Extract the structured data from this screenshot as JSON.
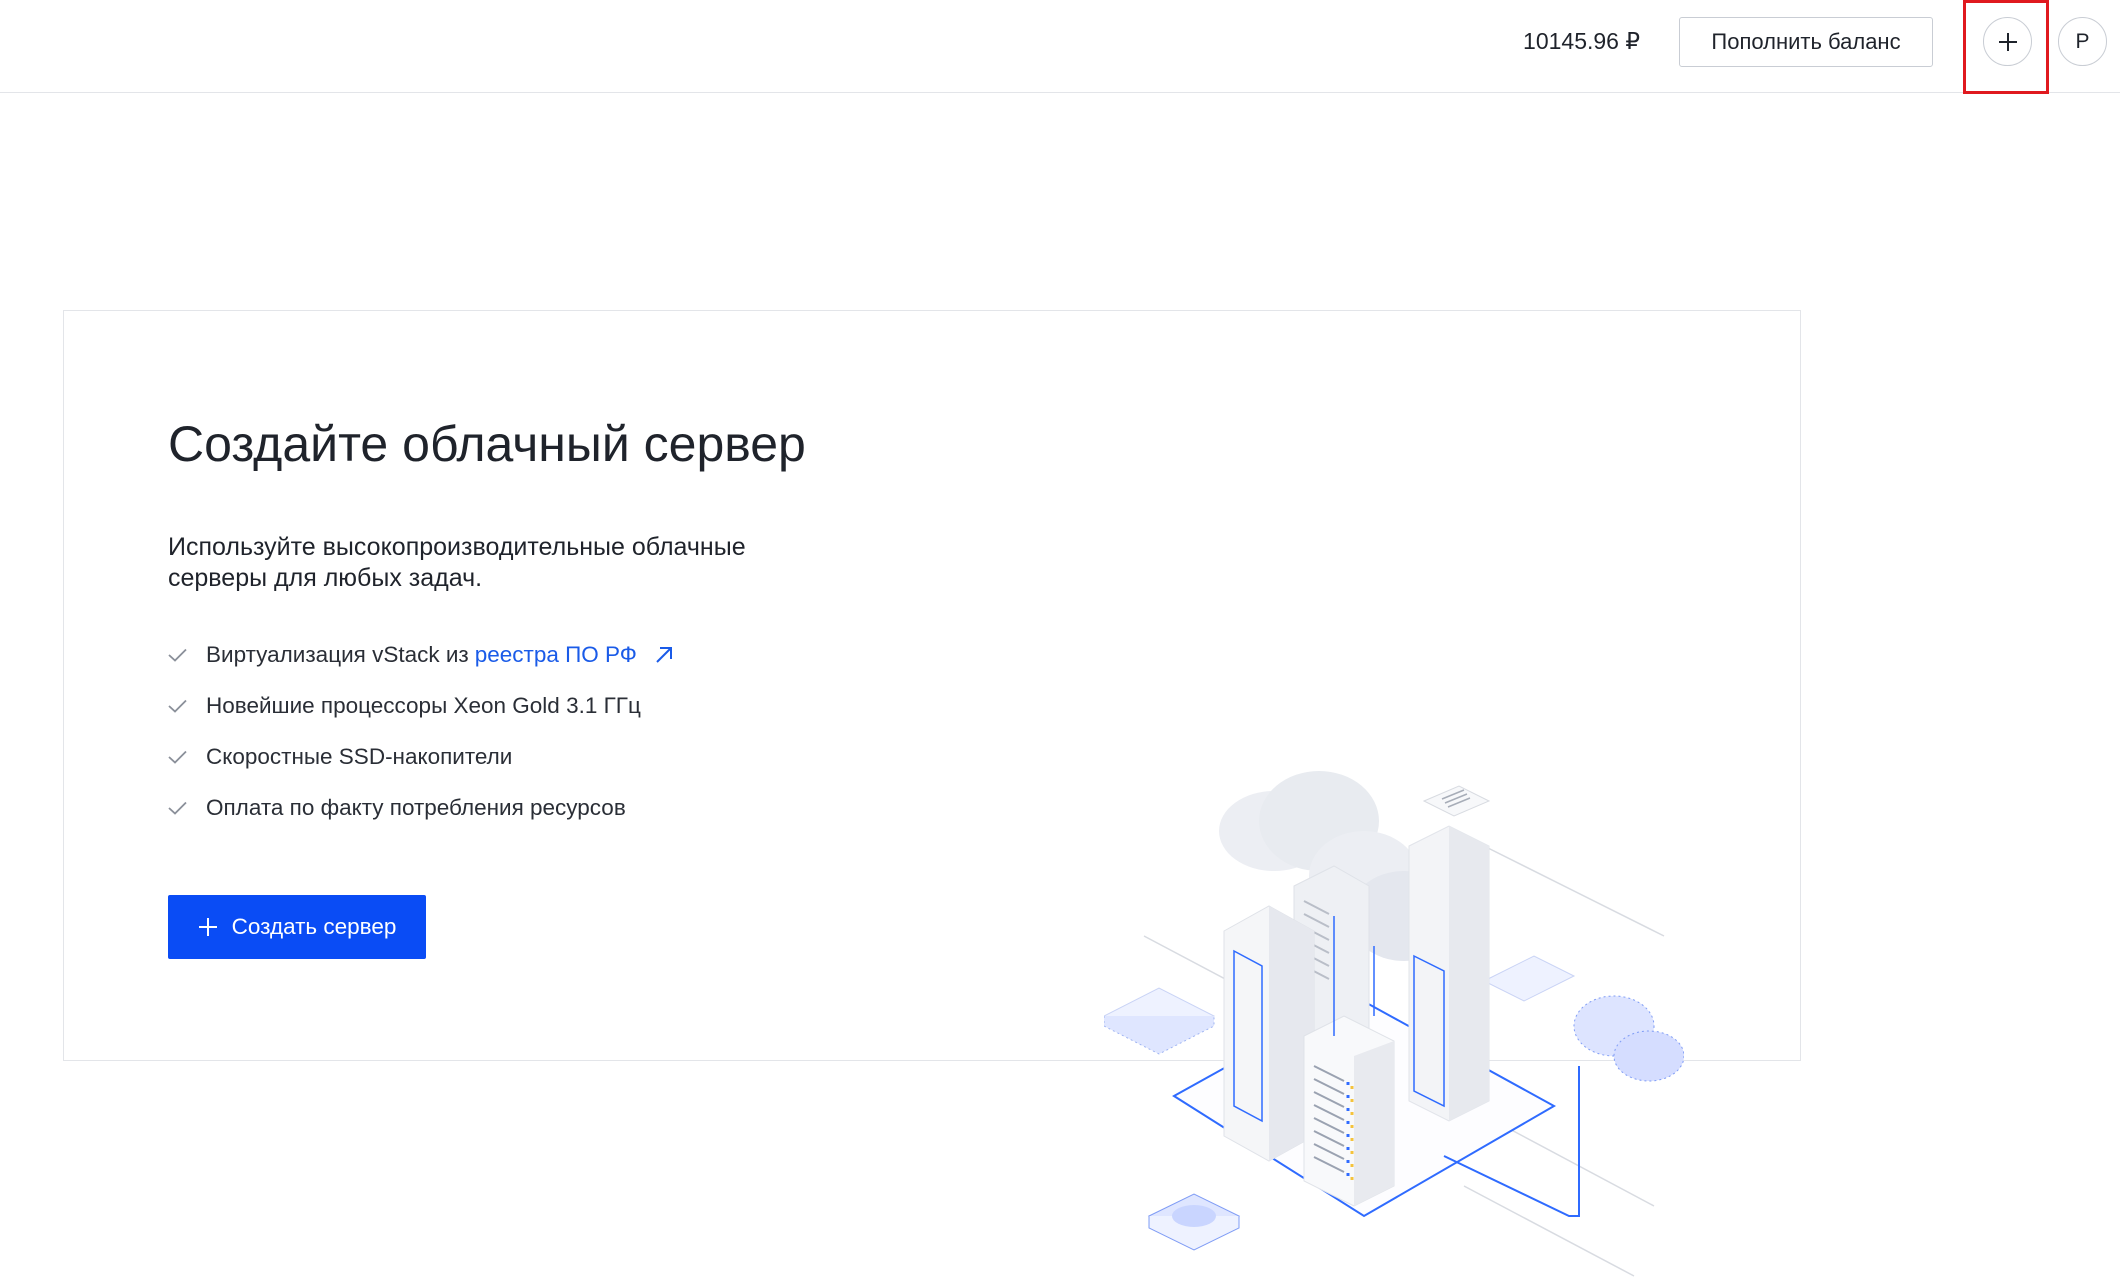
{
  "header": {
    "balance": "10145.96 ₽",
    "topup_label": "Пополнить баланс",
    "avatar_letter": "Р"
  },
  "card": {
    "title": "Создайте облачный сервер",
    "description": "Используйте высокопроизводительные облачные серверы для любых задач.",
    "features": [
      {
        "text": "Виртуализация vStack из",
        "link": "реестра ПО РФ"
      },
      {
        "text": "Новейшие процессоры Xeon Gold 3.1 ГГц"
      },
      {
        "text": "Скоростные SSD-накопители"
      },
      {
        "text": "Оплата по факту потребления ресурсов"
      }
    ],
    "create_button": "Создать сервер"
  },
  "colors": {
    "accent": "#0a4cf5",
    "link": "#1a5be8",
    "highlight": "#e0191f",
    "border": "#e3e5e9"
  },
  "icons": [
    "plus-icon",
    "check-icon",
    "external-link-icon",
    "server-cloud-illustration"
  ]
}
